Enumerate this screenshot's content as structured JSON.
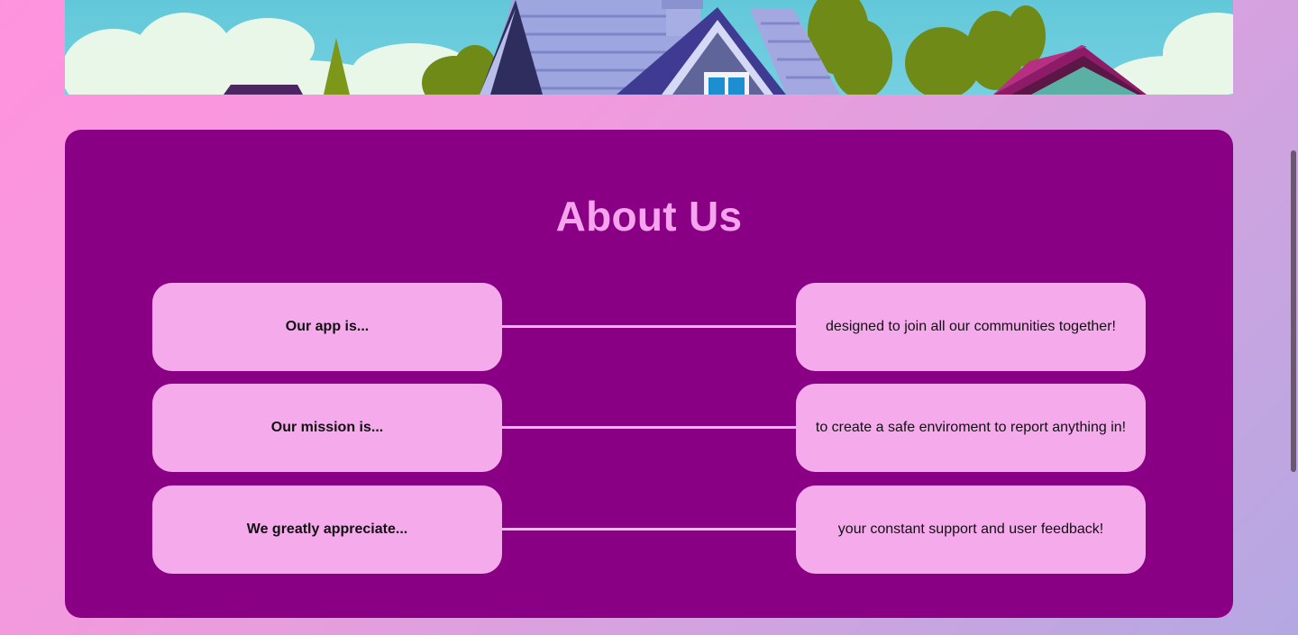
{
  "hero": {
    "image_name": "neighborhood-houses-illustration"
  },
  "about": {
    "title": "About Us",
    "rows": [
      {
        "left": "Our app is...",
        "right": "designed to join all our communities together!"
      },
      {
        "left": "Our mission is...",
        "right": "to create a safe enviroment to report anything in!"
      },
      {
        "left": "We greatly appreciate...",
        "right": "your constant support and user feedback!"
      }
    ]
  },
  "colors": {
    "panel": "#8a0085",
    "card": "#f5abeb",
    "title": "#f7a4ee",
    "background_start": "#ff93dd",
    "background_end": "#b4a8e2"
  }
}
